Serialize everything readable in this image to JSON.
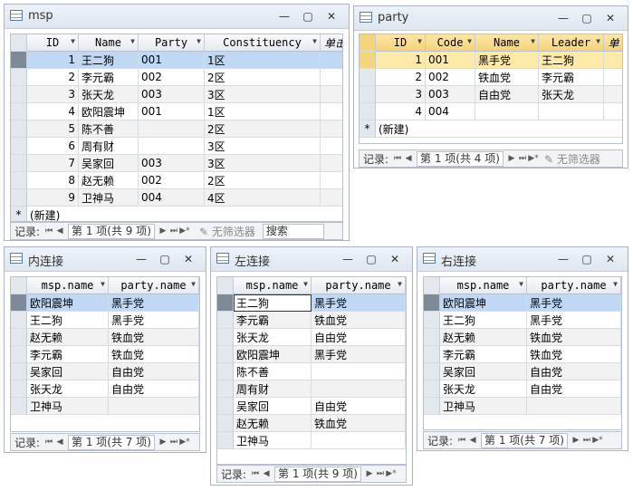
{
  "nav": {
    "record_label": "记录:",
    "first": "⏮",
    "prev": "◀",
    "next": "▶",
    "last": "⏭",
    "new": "▶*",
    "no_filter": "无筛选器",
    "search": "搜索"
  },
  "new_label": "(新建)",
  "new_marker": "*",
  "current_marker": "▶",
  "msp": {
    "title": "msp",
    "columns": [
      "ID",
      "Name",
      "Party",
      "Constituency",
      "单击"
    ],
    "rows": [
      [
        "1",
        "王二狗",
        "001",
        "1区"
      ],
      [
        "2",
        "李元霸",
        "002",
        "2区"
      ],
      [
        "3",
        "张天龙",
        "003",
        "3区"
      ],
      [
        "4",
        "欧阳震坤",
        "001",
        "1区"
      ],
      [
        "5",
        "陈不善",
        "",
        "2区"
      ],
      [
        "6",
        "周有财",
        "",
        "3区"
      ],
      [
        "7",
        "吴家回",
        "003",
        "3区"
      ],
      [
        "8",
        "赵无赖",
        "002",
        "2区"
      ],
      [
        "9",
        "卫神马",
        "004",
        "4区"
      ]
    ],
    "position": "第 1 项(共 9 项)"
  },
  "party": {
    "title": "party",
    "columns": [
      "ID",
      "Code",
      "Name",
      "Leader",
      "单"
    ],
    "rows": [
      [
        "1",
        "001",
        "黑手党",
        "王二狗"
      ],
      [
        "2",
        "002",
        "铁血党",
        "李元霸"
      ],
      [
        "3",
        "003",
        "自由党",
        "张天龙"
      ],
      [
        "4",
        "004",
        "",
        ""
      ]
    ],
    "position": "第 1 项(共 4 项)"
  },
  "inner": {
    "title": "内连接",
    "columns": [
      "msp.name",
      "party.name"
    ],
    "rows": [
      [
        "欧阳震坤",
        "黑手党"
      ],
      [
        "王二狗",
        "黑手党"
      ],
      [
        "赵无赖",
        "铁血党"
      ],
      [
        "李元霸",
        "铁血党"
      ],
      [
        "吴家回",
        "自由党"
      ],
      [
        "张天龙",
        "自由党"
      ],
      [
        "卫神马",
        ""
      ]
    ],
    "position": "第 1 项(共 7 项)"
  },
  "left": {
    "title": "左连接",
    "columns": [
      "msp.name",
      "party.name"
    ],
    "rows": [
      [
        "王二狗",
        "黑手党"
      ],
      [
        "李元霸",
        "铁血党"
      ],
      [
        "张天龙",
        "自由党"
      ],
      [
        "欧阳震坤",
        "黑手党"
      ],
      [
        "陈不善",
        ""
      ],
      [
        "周有财",
        ""
      ],
      [
        "吴家回",
        "自由党"
      ],
      [
        "赵无赖",
        "铁血党"
      ],
      [
        "卫神马",
        ""
      ]
    ],
    "position": "第 1 项(共 9 项)"
  },
  "right": {
    "title": "右连接",
    "columns": [
      "msp.name",
      "party.name"
    ],
    "rows": [
      [
        "欧阳震坤",
        "黑手党"
      ],
      [
        "王二狗",
        "黑手党"
      ],
      [
        "赵无赖",
        "铁血党"
      ],
      [
        "李元霸",
        "铁血党"
      ],
      [
        "吴家回",
        "自由党"
      ],
      [
        "张天龙",
        "自由党"
      ],
      [
        "卫神马",
        ""
      ]
    ],
    "position": "第 1 项(共 7 项)"
  }
}
